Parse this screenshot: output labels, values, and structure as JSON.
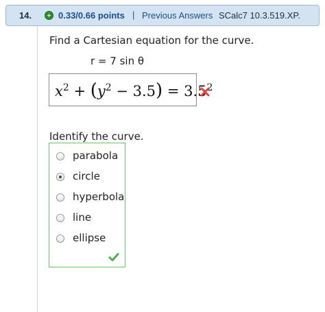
{
  "header": {
    "number": "14.",
    "points": "0.33/0.66 points",
    "separator": "|",
    "previous_answers": "Previous Answers",
    "question_id": "SCalc7 10.3.519.XP."
  },
  "question": {
    "prompt": "Find a Cartesian equation for the curve.",
    "equation": "r = 7 sin θ",
    "answer": {
      "x_term": "x",
      "exp1": "2",
      "plus": " + ",
      "open_paren": "(",
      "y_term": "y",
      "exp2": "2",
      "minus_part": " − 3.5",
      "close_paren": ")",
      "equals_part": " = 3.5",
      "exp3": "2"
    },
    "answer_status": "incorrect"
  },
  "identify": {
    "prompt": "Identify the curve.",
    "options": [
      "parabola",
      "circle",
      "hyperbola",
      "line",
      "ellipse"
    ],
    "selected": "circle",
    "status": "correct"
  },
  "colors": {
    "header_bg": "#d4e3f2",
    "link": "#1a4d8c",
    "incorrect": "#e0443e",
    "correct": "#4caf50",
    "choice_border": "#6cc26c"
  }
}
